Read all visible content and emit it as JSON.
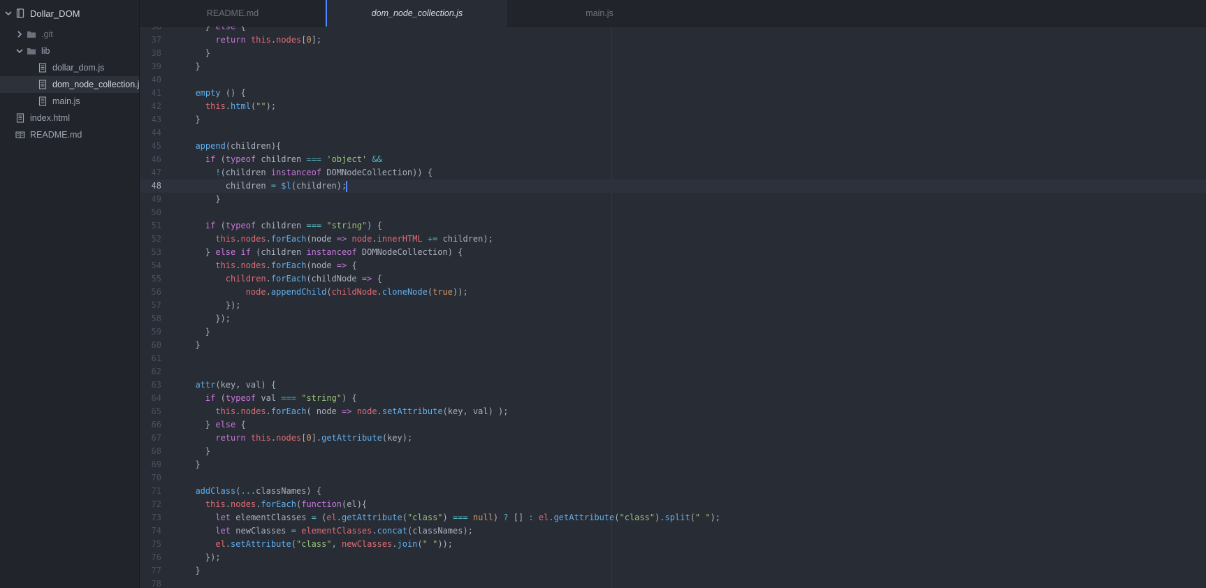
{
  "tree": {
    "root": "Dollar_DOM",
    "items": [
      {
        "label": ".git",
        "kind": "folder",
        "depth": 1,
        "expanded": false,
        "dim": true
      },
      {
        "label": "lib",
        "kind": "folder",
        "depth": 1,
        "expanded": true
      },
      {
        "label": "dollar_dom.js",
        "kind": "file",
        "depth": 2
      },
      {
        "label": "dom_node_collection.js",
        "kind": "file",
        "depth": 2,
        "selected": true
      },
      {
        "label": "main.js",
        "kind": "file",
        "depth": 2
      },
      {
        "label": "index.html",
        "kind": "file",
        "depth": 1
      },
      {
        "label": "README.md",
        "kind": "book",
        "depth": 1
      }
    ]
  },
  "tabs": [
    {
      "label": "README.md",
      "active": false
    },
    {
      "label": "dom_node_collection.js",
      "active": true
    },
    {
      "label": "main.js",
      "active": false
    }
  ],
  "editor": {
    "cursor_line": 48,
    "colors": {
      "plain": "#abb2bf",
      "keyword": "#c678dd",
      "function": "#61afef",
      "variable": "#e06c75",
      "string": "#98c379",
      "number": "#d19a66",
      "operator": "#56b6c2"
    },
    "lines": [
      {
        "n": 36,
        "t": [
          [
            "    } ",
            "p"
          ],
          [
            "else",
            "k"
          ],
          [
            " {",
            "p"
          ]
        ]
      },
      {
        "n": 37,
        "t": [
          [
            "      ",
            "p"
          ],
          [
            "return",
            "k"
          ],
          [
            " ",
            "p"
          ],
          [
            "this",
            "v"
          ],
          [
            ".",
            "p"
          ],
          [
            "nodes",
            "v"
          ],
          [
            "[",
            "p"
          ],
          [
            "0",
            "n"
          ],
          [
            "];",
            "p"
          ]
        ]
      },
      {
        "n": 38,
        "t": [
          [
            "    }",
            "p"
          ]
        ]
      },
      {
        "n": 39,
        "t": [
          [
            "  }",
            "p"
          ]
        ]
      },
      {
        "n": 40,
        "t": []
      },
      {
        "n": 41,
        "t": [
          [
            "  ",
            "p"
          ],
          [
            "empty",
            "f"
          ],
          [
            " () {",
            "p"
          ]
        ]
      },
      {
        "n": 42,
        "t": [
          [
            "    ",
            "p"
          ],
          [
            "this",
            "v"
          ],
          [
            ".",
            "p"
          ],
          [
            "html",
            "f"
          ],
          [
            "(",
            "p"
          ],
          [
            "\"\"",
            "s"
          ],
          [
            ");",
            "p"
          ]
        ]
      },
      {
        "n": 43,
        "t": [
          [
            "  }",
            "p"
          ]
        ]
      },
      {
        "n": 44,
        "t": []
      },
      {
        "n": 45,
        "t": [
          [
            "  ",
            "p"
          ],
          [
            "append",
            "f"
          ],
          [
            "(children){",
            "p"
          ]
        ]
      },
      {
        "n": 46,
        "t": [
          [
            "    ",
            "p"
          ],
          [
            "if",
            "k"
          ],
          [
            " (",
            "p"
          ],
          [
            "typeof",
            "k"
          ],
          [
            " children ",
            "p"
          ],
          [
            "===",
            "o"
          ],
          [
            " ",
            "p"
          ],
          [
            "'object'",
            "s"
          ],
          [
            " ",
            "p"
          ],
          [
            "&&",
            "o"
          ]
        ]
      },
      {
        "n": 47,
        "t": [
          [
            "      ",
            "p"
          ],
          [
            "!",
            "o"
          ],
          [
            "(children ",
            "p"
          ],
          [
            "instanceof",
            "k"
          ],
          [
            " DOMNodeCollection)) {",
            "p"
          ]
        ]
      },
      {
        "n": 48,
        "t": [
          [
            "        children ",
            "p"
          ],
          [
            "=",
            "o"
          ],
          [
            " ",
            "p"
          ],
          [
            "$l",
            "f"
          ],
          [
            "(children);",
            "p"
          ]
        ],
        "cursor": true
      },
      {
        "n": 49,
        "t": [
          [
            "      }",
            "p"
          ]
        ]
      },
      {
        "n": 50,
        "t": []
      },
      {
        "n": 51,
        "t": [
          [
            "    ",
            "p"
          ],
          [
            "if",
            "k"
          ],
          [
            " (",
            "p"
          ],
          [
            "typeof",
            "k"
          ],
          [
            " children ",
            "p"
          ],
          [
            "===",
            "o"
          ],
          [
            " ",
            "p"
          ],
          [
            "\"string\"",
            "s"
          ],
          [
            ") {",
            "p"
          ]
        ]
      },
      {
        "n": 52,
        "t": [
          [
            "      ",
            "p"
          ],
          [
            "this",
            "v"
          ],
          [
            ".",
            "p"
          ],
          [
            "nodes",
            "v"
          ],
          [
            ".",
            "p"
          ],
          [
            "forEach",
            "f"
          ],
          [
            "(node ",
            "p"
          ],
          [
            "=>",
            "k"
          ],
          [
            " ",
            "p"
          ],
          [
            "node",
            "v"
          ],
          [
            ".",
            "p"
          ],
          [
            "innerHTML",
            "v"
          ],
          [
            " ",
            "p"
          ],
          [
            "+=",
            "o"
          ],
          [
            " children);",
            "p"
          ]
        ]
      },
      {
        "n": 53,
        "t": [
          [
            "    } ",
            "p"
          ],
          [
            "else",
            "k"
          ],
          [
            " ",
            "p"
          ],
          [
            "if",
            "k"
          ],
          [
            " (children ",
            "p"
          ],
          [
            "instanceof",
            "k"
          ],
          [
            " DOMNodeCollection) {",
            "p"
          ]
        ]
      },
      {
        "n": 54,
        "t": [
          [
            "      ",
            "p"
          ],
          [
            "this",
            "v"
          ],
          [
            ".",
            "p"
          ],
          [
            "nodes",
            "v"
          ],
          [
            ".",
            "p"
          ],
          [
            "forEach",
            "f"
          ],
          [
            "(node ",
            "p"
          ],
          [
            "=>",
            "k"
          ],
          [
            " {",
            "p"
          ]
        ]
      },
      {
        "n": 55,
        "t": [
          [
            "        ",
            "p"
          ],
          [
            "children",
            "v"
          ],
          [
            ".",
            "p"
          ],
          [
            "forEach",
            "f"
          ],
          [
            "(childNode ",
            "p"
          ],
          [
            "=>",
            "k"
          ],
          [
            " {",
            "p"
          ]
        ]
      },
      {
        "n": 56,
        "t": [
          [
            "            ",
            "p"
          ],
          [
            "node",
            "v"
          ],
          [
            ".",
            "p"
          ],
          [
            "appendChild",
            "f"
          ],
          [
            "(",
            "p"
          ],
          [
            "childNode",
            "v"
          ],
          [
            ".",
            "p"
          ],
          [
            "cloneNode",
            "f"
          ],
          [
            "(",
            "p"
          ],
          [
            "true",
            "n"
          ],
          [
            "));",
            "p"
          ]
        ]
      },
      {
        "n": 57,
        "t": [
          [
            "        });",
            "p"
          ]
        ]
      },
      {
        "n": 58,
        "t": [
          [
            "      });",
            "p"
          ]
        ]
      },
      {
        "n": 59,
        "t": [
          [
            "    }",
            "p"
          ]
        ]
      },
      {
        "n": 60,
        "t": [
          [
            "  }",
            "p"
          ]
        ]
      },
      {
        "n": 61,
        "t": []
      },
      {
        "n": 62,
        "t": []
      },
      {
        "n": 63,
        "t": [
          [
            "  ",
            "p"
          ],
          [
            "attr",
            "f"
          ],
          [
            "(key, val) {",
            "p"
          ]
        ]
      },
      {
        "n": 64,
        "t": [
          [
            "    ",
            "p"
          ],
          [
            "if",
            "k"
          ],
          [
            " (",
            "p"
          ],
          [
            "typeof",
            "k"
          ],
          [
            " val ",
            "p"
          ],
          [
            "===",
            "o"
          ],
          [
            " ",
            "p"
          ],
          [
            "\"string\"",
            "s"
          ],
          [
            ") {",
            "p"
          ]
        ]
      },
      {
        "n": 65,
        "t": [
          [
            "      ",
            "p"
          ],
          [
            "this",
            "v"
          ],
          [
            ".",
            "p"
          ],
          [
            "nodes",
            "v"
          ],
          [
            ".",
            "p"
          ],
          [
            "forEach",
            "f"
          ],
          [
            "( node ",
            "p"
          ],
          [
            "=>",
            "k"
          ],
          [
            " ",
            "p"
          ],
          [
            "node",
            "v"
          ],
          [
            ".",
            "p"
          ],
          [
            "setAttribute",
            "f"
          ],
          [
            "(key, val) );",
            "p"
          ]
        ]
      },
      {
        "n": 66,
        "t": [
          [
            "    } ",
            "p"
          ],
          [
            "else",
            "k"
          ],
          [
            " {",
            "p"
          ]
        ]
      },
      {
        "n": 67,
        "t": [
          [
            "      ",
            "p"
          ],
          [
            "return",
            "k"
          ],
          [
            " ",
            "p"
          ],
          [
            "this",
            "v"
          ],
          [
            ".",
            "p"
          ],
          [
            "nodes",
            "v"
          ],
          [
            "[",
            "p"
          ],
          [
            "0",
            "n"
          ],
          [
            "].",
            "p"
          ],
          [
            "getAttribute",
            "f"
          ],
          [
            "(key);",
            "p"
          ]
        ]
      },
      {
        "n": 68,
        "t": [
          [
            "    }",
            "p"
          ]
        ]
      },
      {
        "n": 69,
        "t": [
          [
            "  }",
            "p"
          ]
        ]
      },
      {
        "n": 70,
        "t": []
      },
      {
        "n": 71,
        "t": [
          [
            "  ",
            "p"
          ],
          [
            "addClass",
            "f"
          ],
          [
            "(",
            "p"
          ],
          [
            "...",
            "o"
          ],
          [
            "classNames) {",
            "p"
          ]
        ]
      },
      {
        "n": 72,
        "t": [
          [
            "    ",
            "p"
          ],
          [
            "this",
            "v"
          ],
          [
            ".",
            "p"
          ],
          [
            "nodes",
            "v"
          ],
          [
            ".",
            "p"
          ],
          [
            "forEach",
            "f"
          ],
          [
            "(",
            "p"
          ],
          [
            "function",
            "k"
          ],
          [
            "(el){",
            "p"
          ]
        ]
      },
      {
        "n": 73,
        "t": [
          [
            "      ",
            "p"
          ],
          [
            "let",
            "k"
          ],
          [
            " elementClasses ",
            "p"
          ],
          [
            "=",
            "o"
          ],
          [
            " (",
            "p"
          ],
          [
            "el",
            "v"
          ],
          [
            ".",
            "p"
          ],
          [
            "getAttribute",
            "f"
          ],
          [
            "(",
            "p"
          ],
          [
            "\"class\"",
            "s"
          ],
          [
            ") ",
            "p"
          ],
          [
            "===",
            "o"
          ],
          [
            " ",
            "p"
          ],
          [
            "null",
            "n"
          ],
          [
            ") ",
            "p"
          ],
          [
            "?",
            "o"
          ],
          [
            " [] ",
            "p"
          ],
          [
            ":",
            "o"
          ],
          [
            " ",
            "p"
          ],
          [
            "el",
            "v"
          ],
          [
            ".",
            "p"
          ],
          [
            "getAttribute",
            "f"
          ],
          [
            "(",
            "p"
          ],
          [
            "\"class\"",
            "s"
          ],
          [
            ").",
            "p"
          ],
          [
            "split",
            "f"
          ],
          [
            "(",
            "p"
          ],
          [
            "\" \"",
            "s"
          ],
          [
            ");",
            "p"
          ]
        ]
      },
      {
        "n": 74,
        "t": [
          [
            "      ",
            "p"
          ],
          [
            "let",
            "k"
          ],
          [
            " newClasses ",
            "p"
          ],
          [
            "=",
            "o"
          ],
          [
            " ",
            "p"
          ],
          [
            "elementClasses",
            "v"
          ],
          [
            ".",
            "p"
          ],
          [
            "concat",
            "f"
          ],
          [
            "(classNames);",
            "p"
          ]
        ]
      },
      {
        "n": 75,
        "t": [
          [
            "      ",
            "p"
          ],
          [
            "el",
            "v"
          ],
          [
            ".",
            "p"
          ],
          [
            "setAttribute",
            "f"
          ],
          [
            "(",
            "p"
          ],
          [
            "\"class\"",
            "s"
          ],
          [
            ", ",
            "p"
          ],
          [
            "newClasses",
            "v"
          ],
          [
            ".",
            "p"
          ],
          [
            "join",
            "f"
          ],
          [
            "(",
            "p"
          ],
          [
            "\" \"",
            "s"
          ],
          [
            "));",
            "p"
          ]
        ]
      },
      {
        "n": 76,
        "t": [
          [
            "    });",
            "p"
          ]
        ]
      },
      {
        "n": 77,
        "t": [
          [
            "  }",
            "p"
          ]
        ]
      },
      {
        "n": 78,
        "t": []
      }
    ]
  }
}
